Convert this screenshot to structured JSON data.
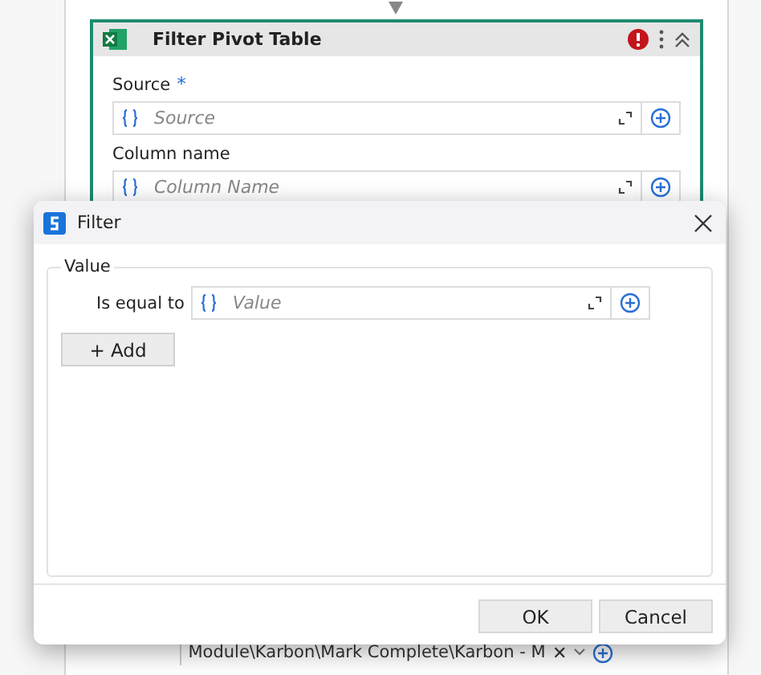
{
  "activity": {
    "title": "Filter Pivot Table",
    "fields": [
      {
        "label": "Source",
        "required_mark": "*",
        "placeholder": "Source"
      },
      {
        "label": "Column name",
        "placeholder": "Column Name"
      }
    ]
  },
  "dialog": {
    "title": "Filter",
    "group": "Value",
    "rows": [
      {
        "label": "Is equal to",
        "placeholder": "Value"
      }
    ],
    "add_button": "+ Add",
    "buttons": [
      {
        "label": "OK"
      },
      {
        "label": "Cancel"
      }
    ]
  },
  "bottom_field": {
    "value": "Module\\Karbon\\Mark Complete\\Karbon - M",
    "close": "✕"
  }
}
